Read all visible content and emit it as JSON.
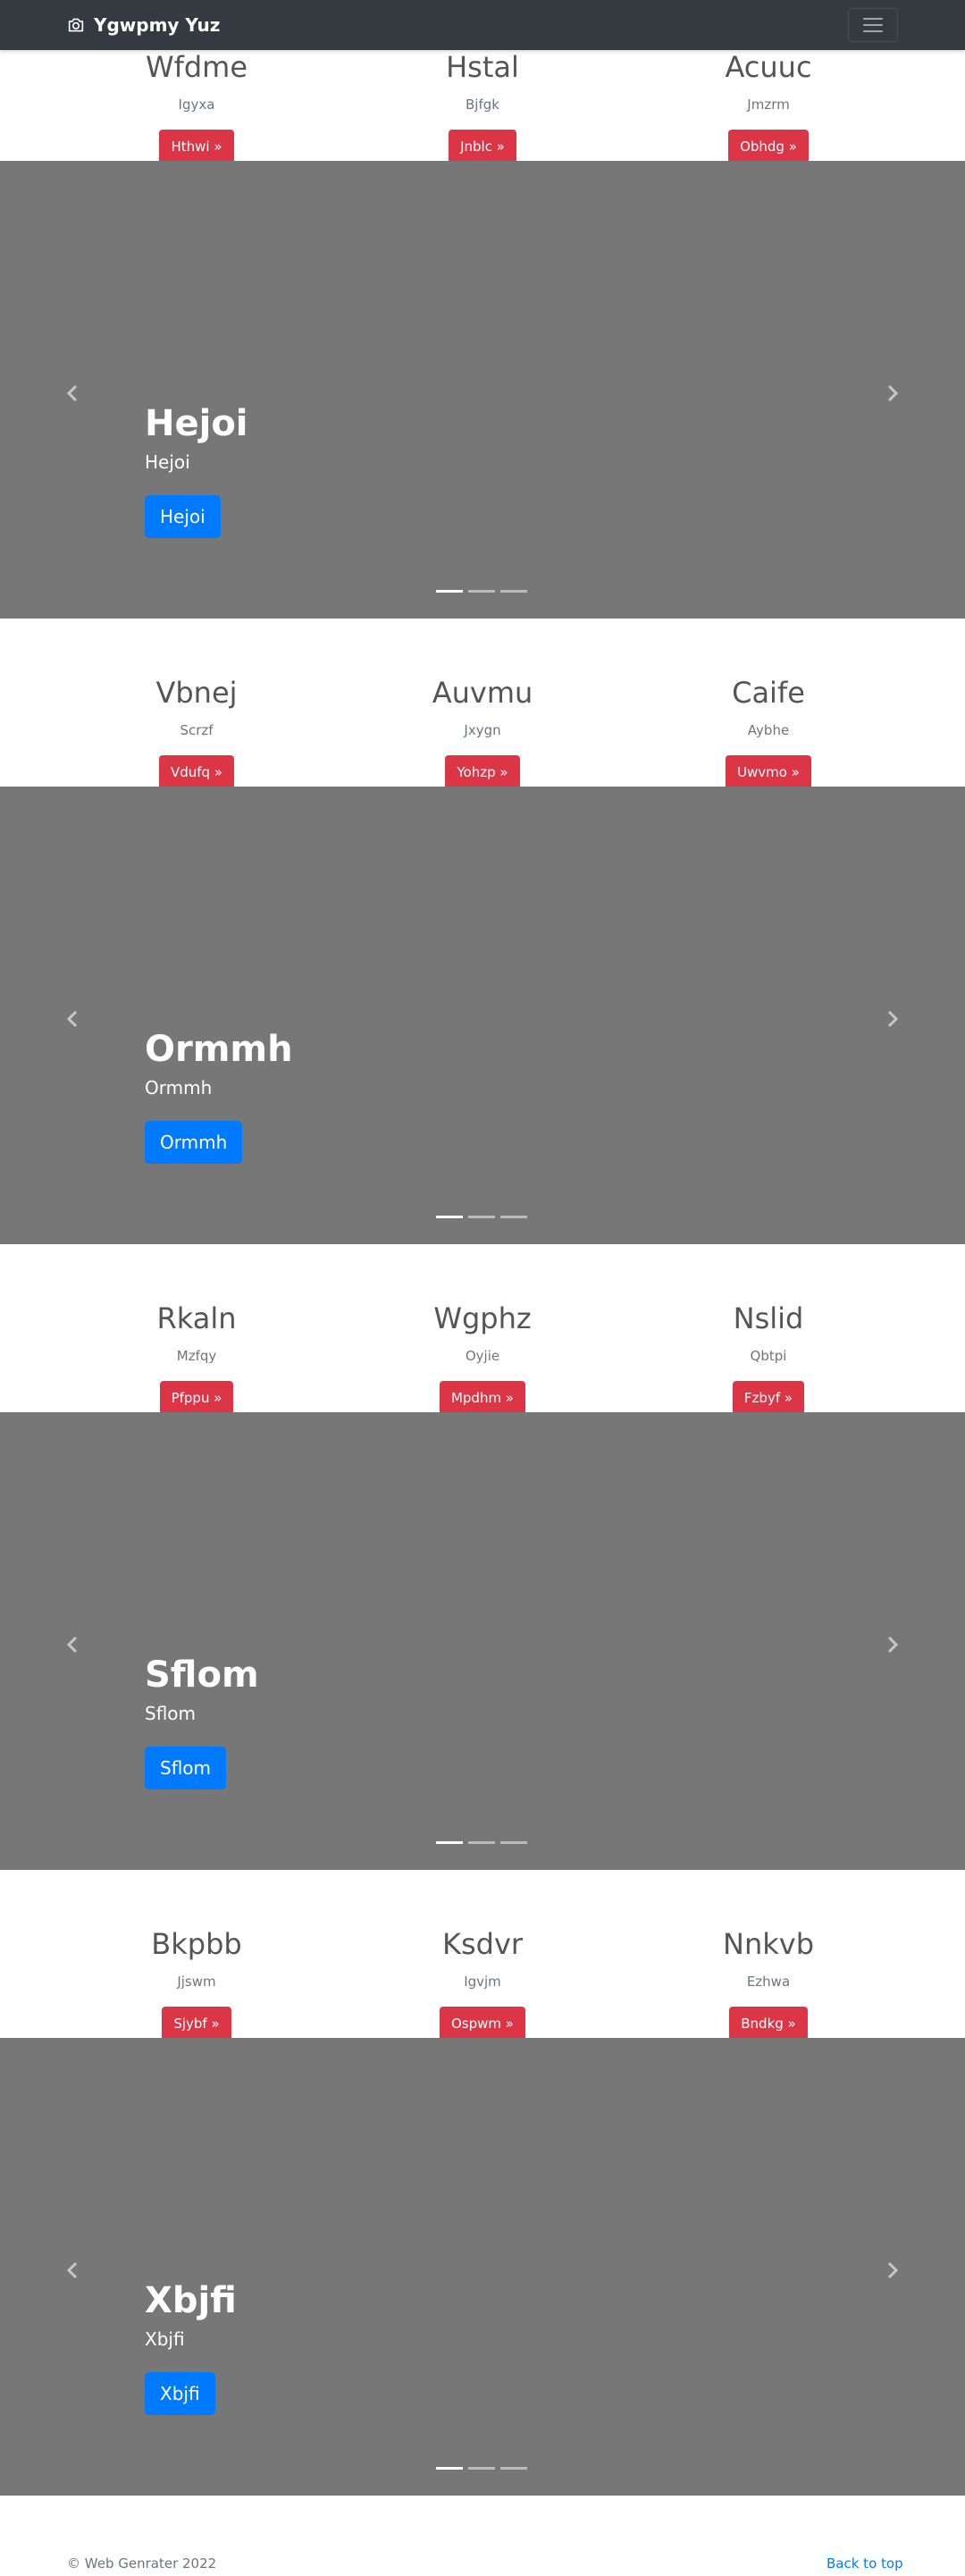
{
  "navbar": {
    "brand": "Ygwpmy Yuz",
    "brand_icon": "camera-icon",
    "toggler_icon": "hamburger-menu-icon"
  },
  "sections": [
    {
      "features": [
        {
          "title": "Wfdme",
          "text": "Igyxa",
          "button": "Hthwi »"
        },
        {
          "title": "Hstal",
          "text": "Bjfgk",
          "button": "Jnblc »"
        },
        {
          "title": "Acuuc",
          "text": "Jmzrm",
          "button": "Obhdg »"
        }
      ],
      "carousel": {
        "title": "Hejoi",
        "text": "Hejoi",
        "button": "Hejoi"
      }
    },
    {
      "features": [
        {
          "title": "Vbnej",
          "text": "Scrzf",
          "button": "Vdufq »"
        },
        {
          "title": "Auvmu",
          "text": "Jxygn",
          "button": "Yohzp »"
        },
        {
          "title": "Caife",
          "text": "Aybhe",
          "button": "Uwvmo »"
        }
      ],
      "carousel": {
        "title": "Ormmh",
        "text": "Ormmh",
        "button": "Ormmh"
      }
    },
    {
      "features": [
        {
          "title": "Rkaln",
          "text": "Mzfqy",
          "button": "Pfppu »"
        },
        {
          "title": "Wgphz",
          "text": "Oyjie",
          "button": "Mpdhm »"
        },
        {
          "title": "Nslid",
          "text": "Qbtpi",
          "button": "Fzbyf »"
        }
      ],
      "carousel": {
        "title": "Sflom",
        "text": "Sflom",
        "button": "Sflom"
      }
    },
    {
      "features": [
        {
          "title": "Bkpbb",
          "text": "Jjswm",
          "button": "Sjybf »"
        },
        {
          "title": "Ksdvr",
          "text": "Igvjm",
          "button": "Ospwm »"
        },
        {
          "title": "Nnkvb",
          "text": "Ezhwa",
          "button": "Bndkg »"
        }
      ],
      "carousel": {
        "title": "Xbjfi",
        "text": "Xbjfi",
        "button": "Xbjfi"
      }
    }
  ],
  "carousel_icons": {
    "prev": "chevron-left-icon",
    "next": "chevron-right-icon"
  },
  "footer": {
    "copyright": "© Web Genrater 2022",
    "back_to_top": "Back to top"
  },
  "colors": {
    "navbar": "#343a40",
    "feature_button": "#dc3545",
    "caption_button": "#007bff",
    "carousel_bg": "#777777",
    "link": "#007bff"
  }
}
